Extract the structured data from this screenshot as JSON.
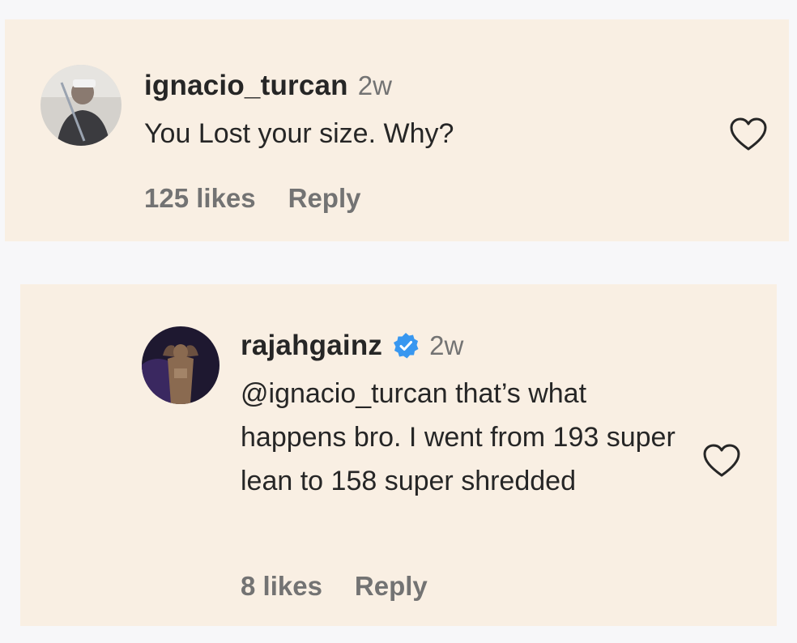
{
  "comment": {
    "username": "ignacio_turcan",
    "time": "2w",
    "text": "You Lost your size. Why?",
    "likes": "125 likes",
    "reply_label": "Reply",
    "avatar_icon": "profile-photo-icon",
    "like_icon": "heart-outline-icon"
  },
  "reply": {
    "username": "rajahgainz",
    "verified": true,
    "verified_icon": "verified-badge-icon",
    "time": "2w",
    "text": "@ignacio_turcan that’s what happens bro. I went from 193 super lean to 158 super shredded",
    "likes": "8 likes",
    "reply_label": "Reply",
    "avatar_icon": "profile-photo-icon",
    "like_icon": "heart-outline-icon"
  },
  "colors": {
    "page_background": "#f7f7f9",
    "card_background": "#f9efe3",
    "primary_text": "#262626",
    "secondary_text": "#737373",
    "verified_blue": "#3897f0"
  }
}
